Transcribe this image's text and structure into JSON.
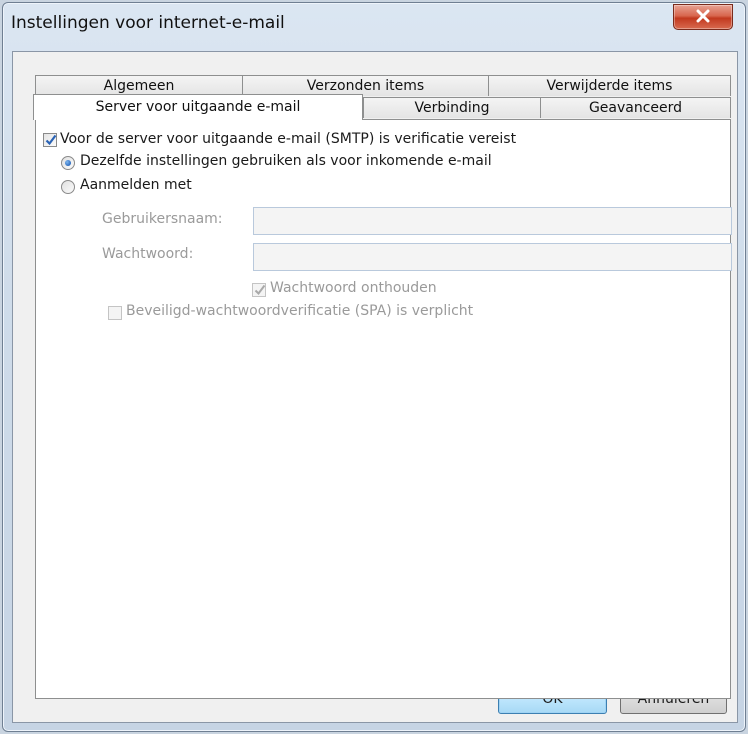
{
  "window": {
    "title": "Instellingen voor internet-e-mail",
    "close_icon": "close-icon"
  },
  "tabs": {
    "row1": [
      "Algemeen",
      "Verzonden items",
      "Verwijderde items"
    ],
    "row2": [
      "Server voor uitgaande e-mail",
      "Verbinding",
      "Geavanceerd"
    ],
    "active": "Server voor uitgaande e-mail"
  },
  "smtp": {
    "requires_auth_label": "Voor de server voor uitgaande e-mail (SMTP) is verificatie vereist",
    "requires_auth_checked": true,
    "same_settings_label": "Dezelfde instellingen gebruiken als voor inkomende e-mail",
    "same_settings_selected": true,
    "login_with_label": "Aanmelden met",
    "login_with_selected": false,
    "username_label": "Gebruikersnaam:",
    "username_value": "",
    "password_label": "Wachtwoord:",
    "password_value": "",
    "remember_password_label": "Wachtwoord onthouden",
    "remember_password_checked": true,
    "spa_label": "Beveiligd-wachtwoordverificatie (SPA) is verplicht",
    "spa_checked": false
  },
  "buttons": {
    "ok": "OK",
    "cancel": "Annuleren"
  },
  "colors": {
    "close_button": "#c94a30",
    "radio_dot": "#2d6cc0",
    "checkmark": "#2a63b5",
    "disabled_text": "#9a9a9a"
  }
}
